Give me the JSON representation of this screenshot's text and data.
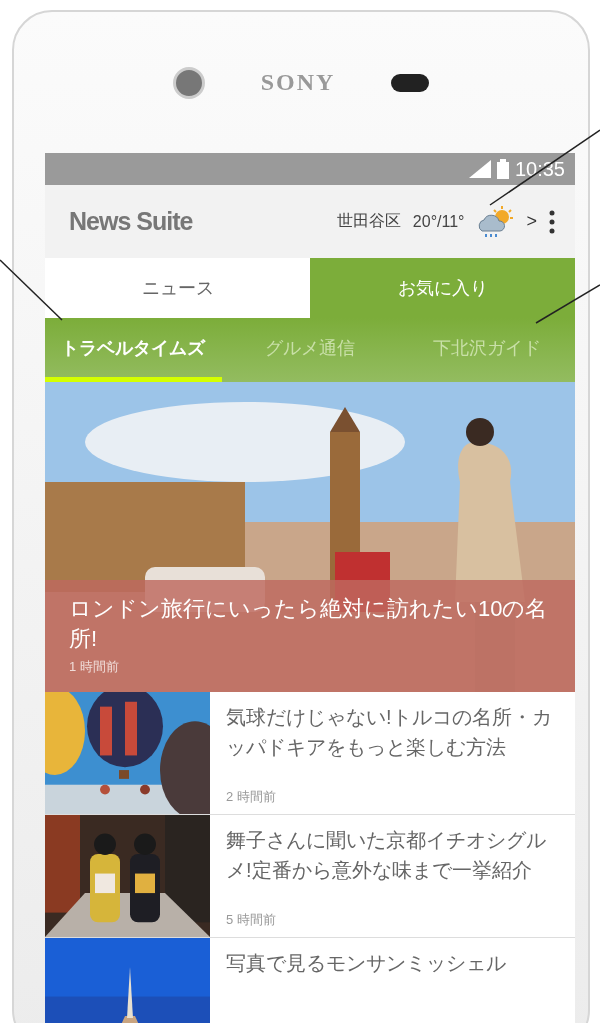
{
  "device": {
    "brand": "SONY"
  },
  "status_bar": {
    "time": "10:35"
  },
  "header": {
    "app_title": "News Suite",
    "location": "世田谷区",
    "temperature": "20°/11°",
    "chevron": ">"
  },
  "tabs": [
    {
      "label": "ニュース",
      "selected": false
    },
    {
      "label": "お気に入り",
      "selected": true
    }
  ],
  "categories": [
    {
      "label": "トラベルタイムズ",
      "selected": true
    },
    {
      "label": "グルメ通信",
      "selected": false
    },
    {
      "label": "下北沢ガイド",
      "selected": false
    }
  ],
  "hero": {
    "title": "ロンドン旅行にいったら絶対に訪れたい10の名所!",
    "time": "1 時間前"
  },
  "articles": [
    {
      "title": "気球だけじゃない!トルコの名所・カッパドキアをもっと楽しむ方法",
      "time": "2 時間前"
    },
    {
      "title": "舞子さんに聞いた京都イチオシグルメ!定番から意外な味まで一挙紹介",
      "time": "5 時間前"
    },
    {
      "title": "写真で見るモンサンミッシェル"
    }
  ]
}
